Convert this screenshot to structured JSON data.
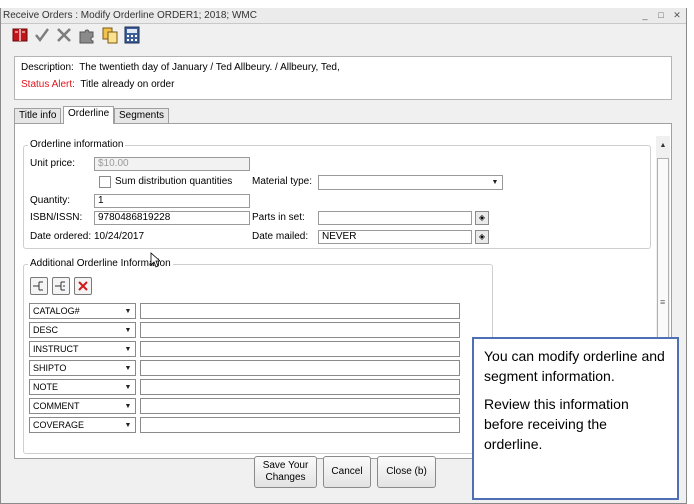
{
  "window": {
    "title": "Receive Orders : Modify Orderline  ORDER1; 2018; WMC",
    "minimize": "_",
    "maximize": "□",
    "close": "✕"
  },
  "toolbar": {
    "icons": [
      "book-icon",
      "checkmark-icon",
      "cross-tools-icon",
      "puzzle-icon",
      "files-icon",
      "calculator-icon"
    ]
  },
  "description": {
    "label": "Description:",
    "value": "The twentieth day of January / Ted Allbeury. / Allbeury, Ted,",
    "alert_label": "Status Alert:",
    "alert_value": "Title already on order"
  },
  "tabs": [
    {
      "label": "Title info"
    },
    {
      "label": "Orderline"
    },
    {
      "label": "Segments"
    }
  ],
  "orderline_info": {
    "legend": "Orderline information",
    "unit_price_label": "Unit price:",
    "unit_price_value": "$10.00",
    "sum_distribution_label": "Sum distribution quantities",
    "material_type_label": "Material type:",
    "material_type_value": "",
    "quantity_label": "Quantity:",
    "quantity_value": "1",
    "isbn_label": "ISBN/ISSN:",
    "isbn_value": "9780486819228",
    "parts_label": "Parts in set:",
    "parts_value": "",
    "date_ordered_label": "Date ordered:",
    "date_ordered_value": "10/24/2017",
    "date_mailed_label": "Date mailed:",
    "date_mailed_value": "NEVER"
  },
  "additional_info": {
    "legend": "Additional Orderline Information",
    "rows": [
      {
        "code": "CATALOG#",
        "value": ""
      },
      {
        "code": "DESC",
        "value": ""
      },
      {
        "code": "INSTRUCT",
        "value": ""
      },
      {
        "code": "SHIPTO",
        "value": ""
      },
      {
        "code": "NOTE",
        "value": ""
      },
      {
        "code": "COMMENT",
        "value": ""
      },
      {
        "code": "COVERAGE",
        "value": ""
      }
    ]
  },
  "buttons": {
    "save": "Save Your Changes",
    "cancel": "Cancel",
    "close": "Close (b)"
  },
  "callout": {
    "line1": "You can modify orderline and segment information.",
    "line2": "Review this information before receiving the orderline."
  },
  "colors": {
    "alert": "#e1141e",
    "callout_border": "#4f6fb4"
  }
}
